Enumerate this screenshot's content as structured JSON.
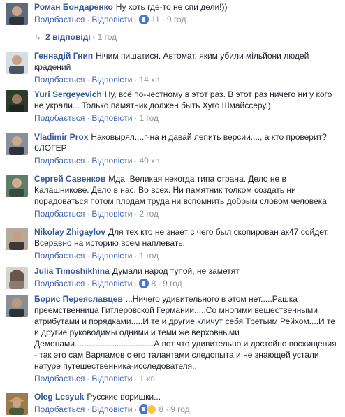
{
  "comments": [
    {
      "author": "Роман Бондаренко",
      "text": "Ну хоть где-то не спи  дели!))",
      "like": "Подобається",
      "reply": "Відповісти",
      "reactions": "11",
      "time": "9 год",
      "avatar_color": "#5e6b7a"
    },
    {
      "author": "Геннадій Гнип",
      "text": "Нічим пишатися. Автомат, яким убили мільйони людей крадений",
      "like": "Подобається",
      "reply": "Відповісти",
      "time": "14 хв",
      "avatar_color": "#8b8f95"
    },
    {
      "author": "Yuri Sergeyevich",
      "text": "Ну, всё по-честному в этот раз. В этот раз ничего ни у кого не украли... Только памятник должен быть Хуго Шмайссеру.)",
      "like": "Подобається",
      "reply": "Відповісти",
      "time": "1 год",
      "avatar_color": "#2f3a2f"
    },
    {
      "author": "Vladimir Prox",
      "text": "Наковырял....г-на и давай лепить версии...., а кто проверит? бЛОГЕР",
      "like": "Подобається",
      "reply": "Відповісти",
      "time": "40 хв",
      "avatar_color": "#6d7278"
    },
    {
      "author": "Сергей Савенков",
      "text": "Мда. Великая некогда типа страна. Дело не в Калашникове. Дело в нас. Во всех. Ни памятник толком создать ни порадоваться потом плодам труда ни вспомнить добрым словом человека",
      "like": "Подобається",
      "reply": "Відповісти",
      "time": "2 год",
      "avatar_color": "#4c6a5a"
    },
    {
      "author": "Nikolay Zhigaylov",
      "text": "Для тех кто не знает с чего был скопирован ак47 сойдет. Всеравно на историю всем наплевать.",
      "like": "Подобається",
      "reply": "Відповісти",
      "time": "1 год",
      "avatar_color": "#7b6a5a"
    },
    {
      "author": "Julia Timoshikhina",
      "text": "Думали народ тупой, не заметят",
      "like": "Подобається",
      "reply": "Відповісти",
      "reactions": "8",
      "time": "9 год",
      "avatar_color": "#b9b2ad"
    },
    {
      "author": "Борис Переяславцев",
      "text": "...Ничего удивительного в этом нет.....Рашка преемственница Гитлеровской Германии.....Со многими вещественными атрибутами и порядками.....И те и другие кличут себя Третьим Рейхом....И те и другие руководимы одними и теми же верховными Демонами..................................А вот что удивительно и достойно восхищения - так это сам Варламов с его талантами следопыта и не знающей устали натуре путешественника-исследователя..",
      "like": "Подобається",
      "reply": "Відповісти",
      "time": "1 хв.",
      "avatar_color": "#8a8f94"
    },
    {
      "author": "Oleg Lesyuk",
      "text": "Русские воришки...",
      "like": "Подобається",
      "reply": "Відповісти",
      "reactions": "8",
      "time": "9 год",
      "avatar_color": "#9a7b4f"
    }
  ],
  "replies_link": {
    "label": "2 відповіді",
    "time": "1 год"
  }
}
